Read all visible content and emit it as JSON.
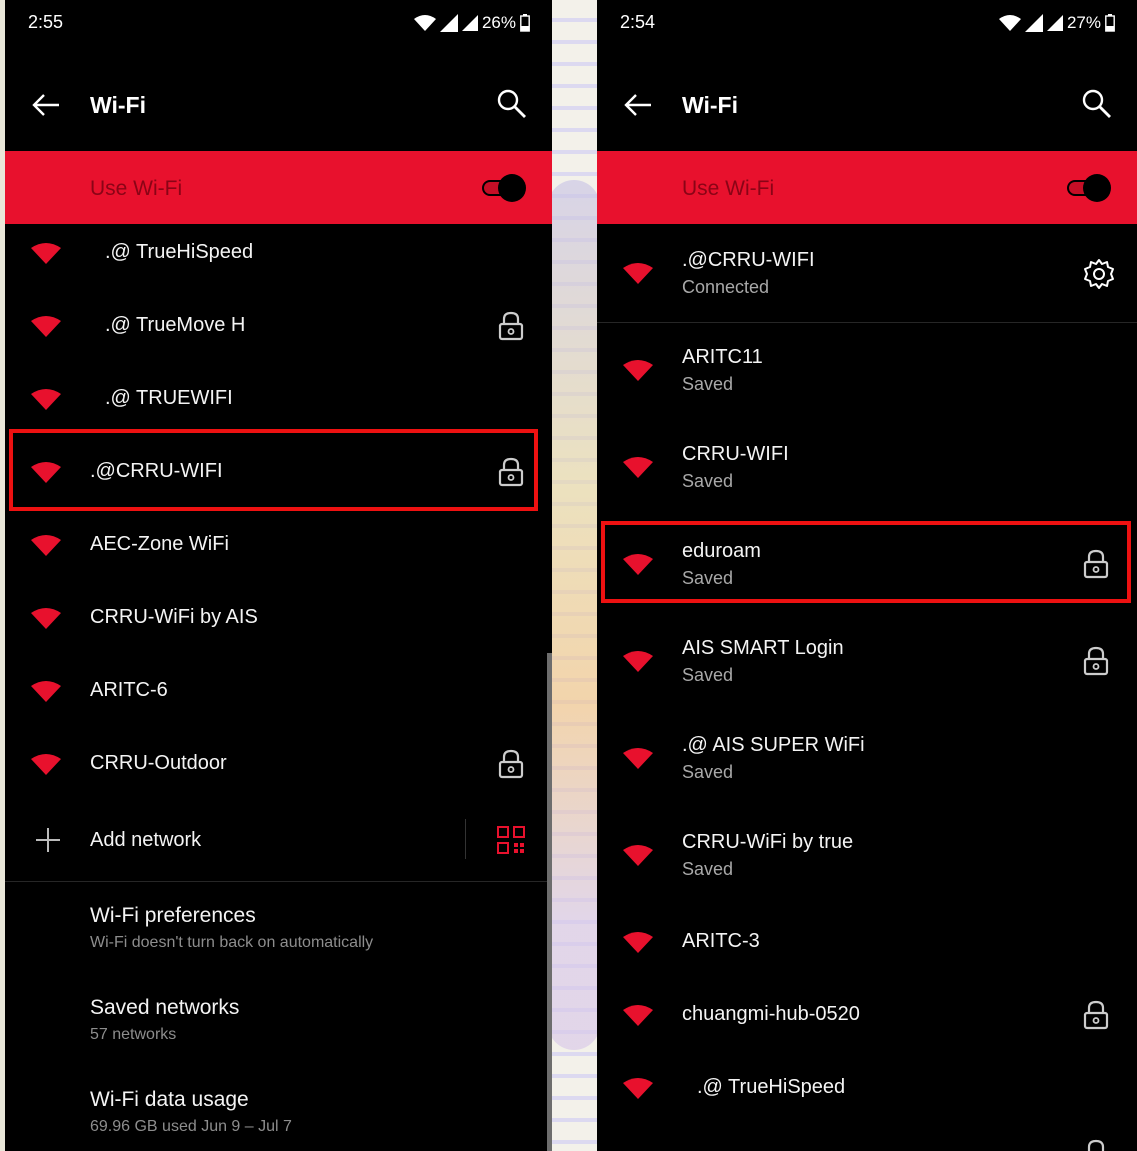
{
  "colors": {
    "accent": "#e8112d",
    "highlight": "#ee1111",
    "background": "#000000"
  },
  "left": {
    "status": {
      "time": "2:55",
      "battery": "26%"
    },
    "header": {
      "title": "Wi-Fi"
    },
    "use_wifi": {
      "label": "Use Wi-Fi",
      "on": true
    },
    "networks": [
      {
        "name": ".@ TrueHiSpeed",
        "locked": false
      },
      {
        "name": ".@ TrueMove H",
        "locked": true
      },
      {
        "name": ".@ TRUEWIFI",
        "locked": false
      },
      {
        "name": ".@CRRU-WIFI",
        "locked": true,
        "highlighted": true
      },
      {
        "name": "AEC-Zone WiFi",
        "locked": false
      },
      {
        "name": "CRRU-WiFi by AIS",
        "locked": false
      },
      {
        "name": "ARITC-6",
        "locked": false
      },
      {
        "name": "CRRU-Outdoor",
        "locked": true
      }
    ],
    "add_network": {
      "label": "Add network"
    },
    "prefs": [
      {
        "title": "Wi-Fi preferences",
        "subtitle": "Wi-Fi doesn't turn back on automatically"
      },
      {
        "title": "Saved networks",
        "subtitle": "57 networks"
      },
      {
        "title": "Wi-Fi data usage",
        "subtitle": "69.96 GB used Jun 9 – Jul 7"
      }
    ]
  },
  "right": {
    "status": {
      "time": "2:54",
      "battery": "27%"
    },
    "header": {
      "title": "Wi-Fi"
    },
    "use_wifi": {
      "label": "Use Wi-Fi",
      "on": true
    },
    "connected": {
      "name": ".@CRRU-WIFI",
      "status": "Connected"
    },
    "networks": [
      {
        "name": "ARITC11",
        "status": "Saved",
        "locked": false
      },
      {
        "name": "CRRU-WIFI",
        "status": "Saved",
        "locked": false
      },
      {
        "name": "eduroam",
        "status": "Saved",
        "locked": true,
        "highlighted": true
      },
      {
        "name": " AIS SMART Login",
        "status": "Saved",
        "locked": true
      },
      {
        "name": ".@ AIS SUPER WiFi",
        "status": "Saved",
        "locked": false
      },
      {
        "name": "CRRU-WiFi by true",
        "status": "Saved",
        "locked": false
      },
      {
        "name": "ARITC-3",
        "locked": false
      },
      {
        "name": "chuangmi-hub-0520",
        "locked": true
      },
      {
        "name": ".@ TrueHiSpeed",
        "locked": false
      }
    ]
  }
}
